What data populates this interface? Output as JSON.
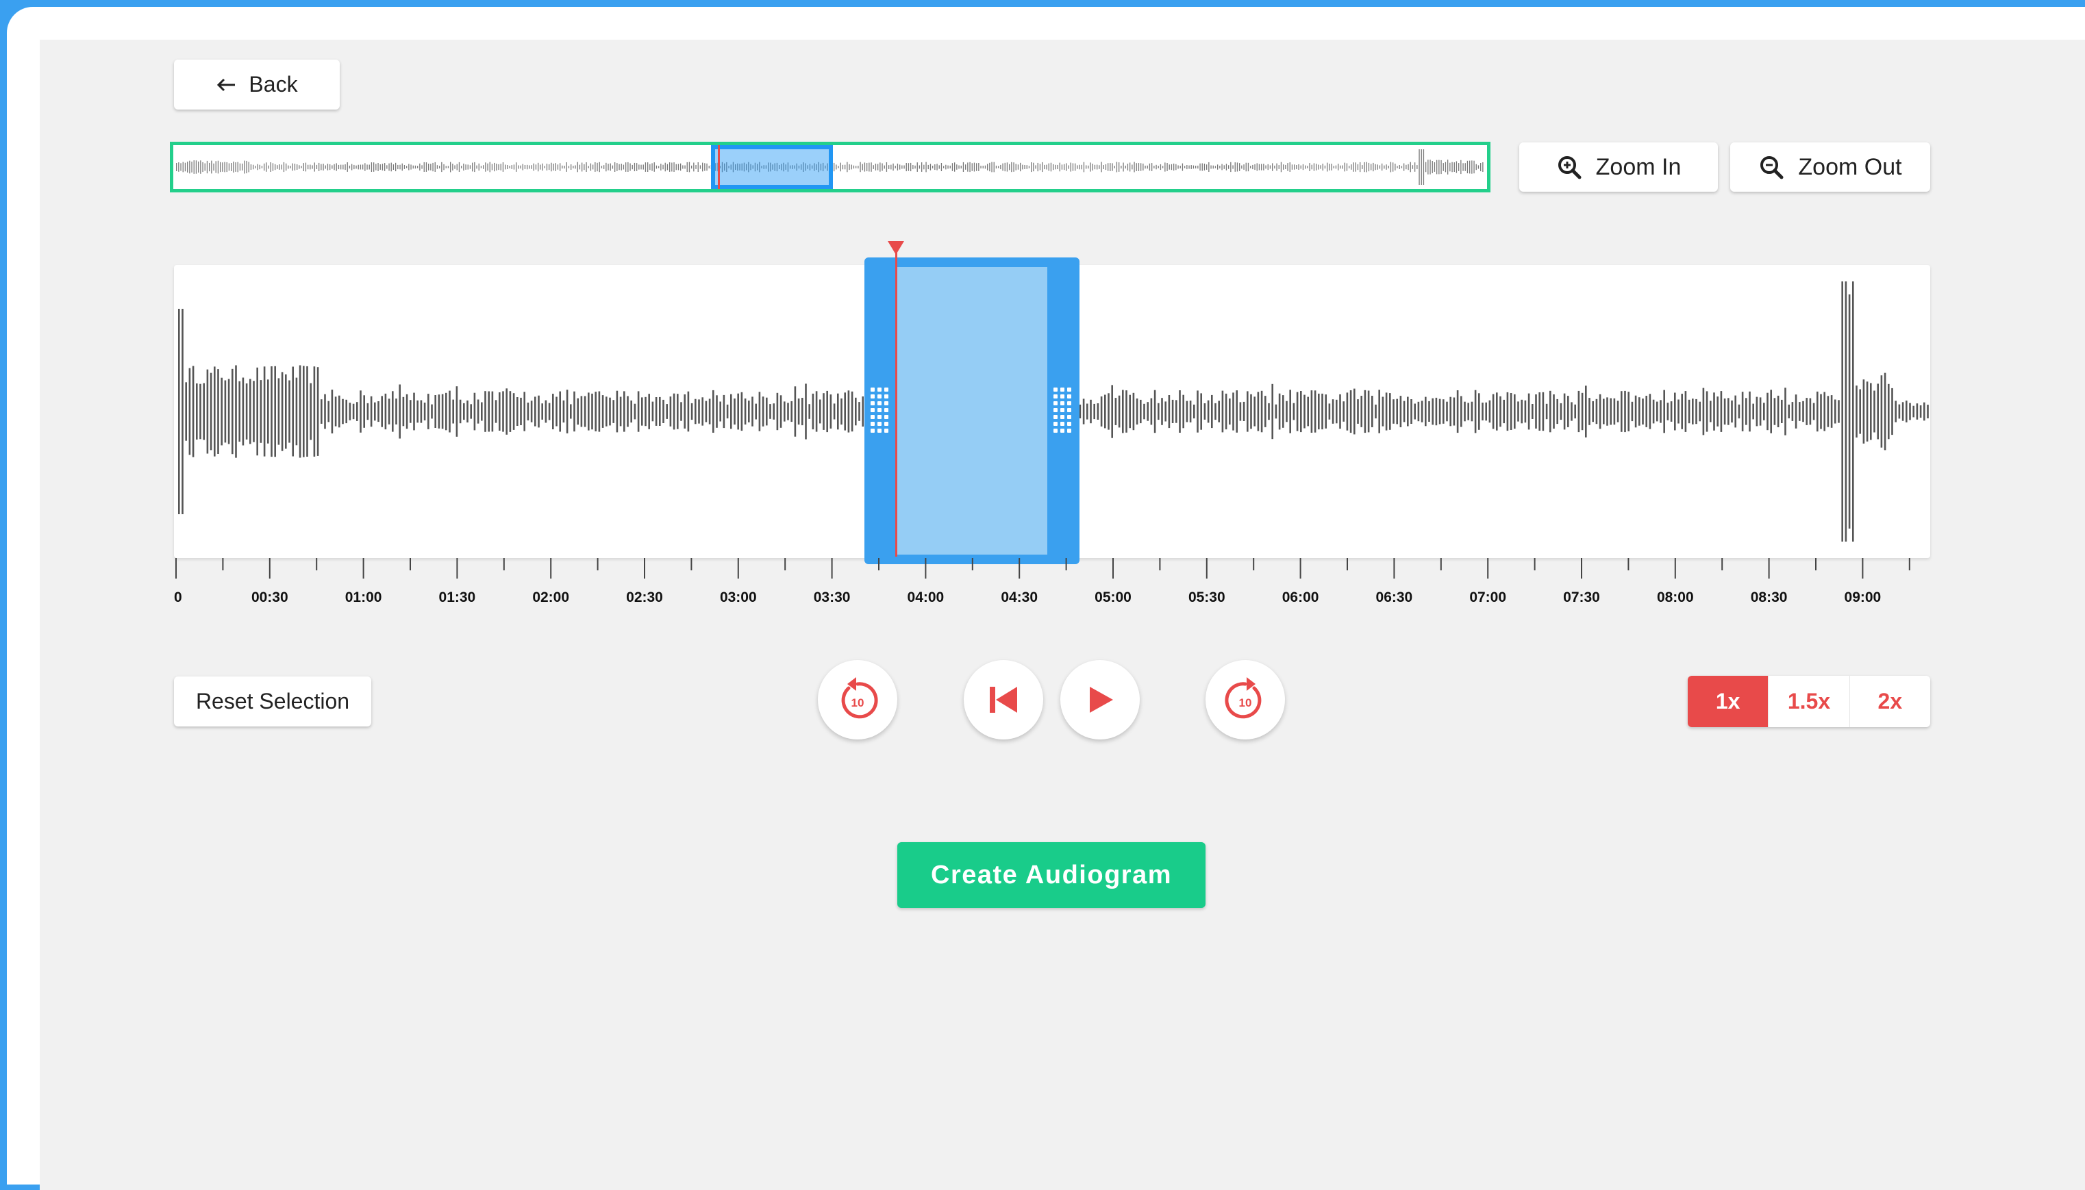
{
  "header": {
    "back_label": "Back",
    "back_icon": "arrow-left-icon"
  },
  "zoom": {
    "zoom_in_label": "Zoom In",
    "zoom_out_label": "Zoom Out",
    "zoom_in_icon": "zoom-in-icon",
    "zoom_out_icon": "zoom-out-icon"
  },
  "timeline": {
    "ticks": [
      "0",
      "00:30",
      "01:00",
      "01:30",
      "02:00",
      "02:30",
      "03:00",
      "03:30",
      "04:00",
      "04:30",
      "05:00",
      "05:30",
      "06:00",
      "06:30",
      "07:00",
      "07:30",
      "08:00",
      "08:30",
      "09:00"
    ]
  },
  "controls": {
    "reset_label": "Reset Selection",
    "rewind_label": "10",
    "forward_label": "10",
    "icons": [
      "rewind-10-icon",
      "skip-to-start-icon",
      "play-icon",
      "forward-10-icon"
    ]
  },
  "speed": {
    "options": [
      "1x",
      "1.5x",
      "2x"
    ],
    "selected": "1x"
  },
  "cta": {
    "create_label": "Create Audiogram"
  },
  "colors": {
    "accent_green": "#19cc8a",
    "accent_red": "#e84a4a",
    "selection_blue": "#3aa0ef",
    "frame_blue": "#3aa0f0"
  }
}
